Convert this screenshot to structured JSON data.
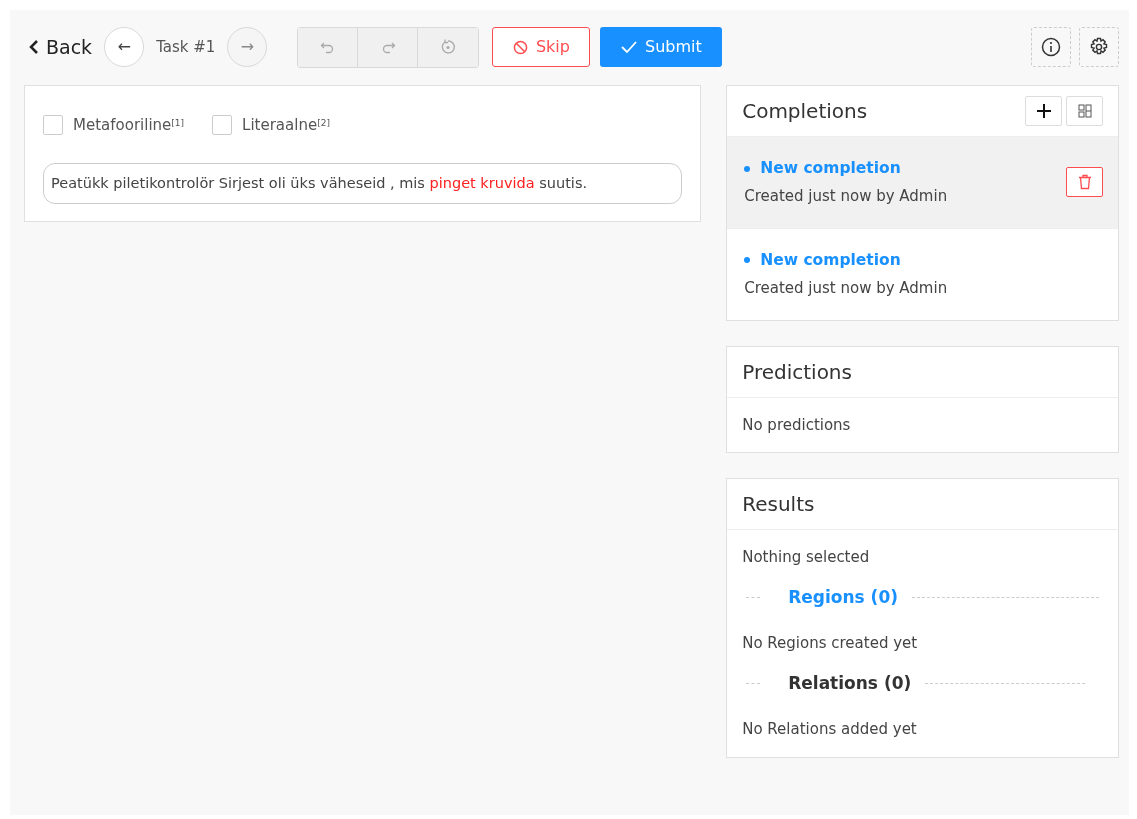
{
  "toolbar": {
    "back": "Back",
    "prev": {
      "label": "←",
      "disabled": false
    },
    "task": "Task #1",
    "next": {
      "label": "→",
      "disabled": true
    },
    "history": [
      {
        "kind": "undo",
        "disabled": true
      },
      {
        "kind": "redo",
        "disabled": true
      },
      {
        "kind": "reset",
        "disabled": true
      }
    ],
    "skip": "Skip",
    "submit": "Submit"
  },
  "editor": {
    "choices": [
      {
        "label": "Metafooriline",
        "hotkey": "[1]",
        "checked": false
      },
      {
        "label": "Literaalne",
        "hotkey": "[2]",
        "checked": false
      }
    ],
    "text": [
      {
        "text": "Peatükk piletikontrolör Sirjest oli üks väheseid , mis ",
        "highlighted": false
      },
      {
        "text": "pinget kruvida",
        "highlighted": true
      },
      {
        "text": " suutis.",
        "highlighted": false
      }
    ]
  },
  "completions": {
    "title": "Completions",
    "items": [
      {
        "name": "New completion",
        "meta": "Created just now by Admin",
        "selected": true
      },
      {
        "name": "New completion",
        "meta": "Created just now by Admin",
        "selected": false
      }
    ]
  },
  "predictions": {
    "title": "Predictions",
    "empty": "No predictions"
  },
  "results": {
    "title": "Results",
    "selection": "Nothing selected",
    "sections": [
      {
        "title": "Regions (0)",
        "highlighted": true,
        "empty": "No Regions created yet"
      },
      {
        "title": "Relations (0)",
        "highlighted": false,
        "empty": "No Relations added yet"
      }
    ]
  }
}
